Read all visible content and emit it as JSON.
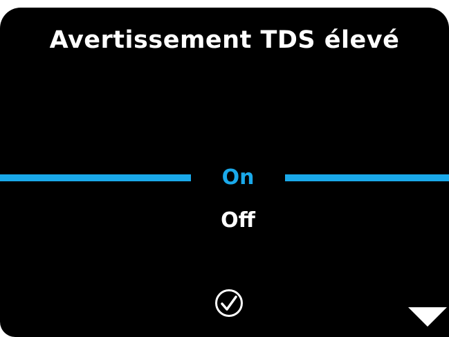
{
  "screen": {
    "title": "Avertissement TDS élevé",
    "options": [
      {
        "label": "On",
        "selected": true
      },
      {
        "label": "Off",
        "selected": false
      }
    ],
    "icons": {
      "confirm": "checkmark-circle-icon",
      "next": "triangle-down-icon"
    },
    "colors": {
      "background": "#000000",
      "accent": "#1aa9ea",
      "text": "#ffffff"
    }
  }
}
